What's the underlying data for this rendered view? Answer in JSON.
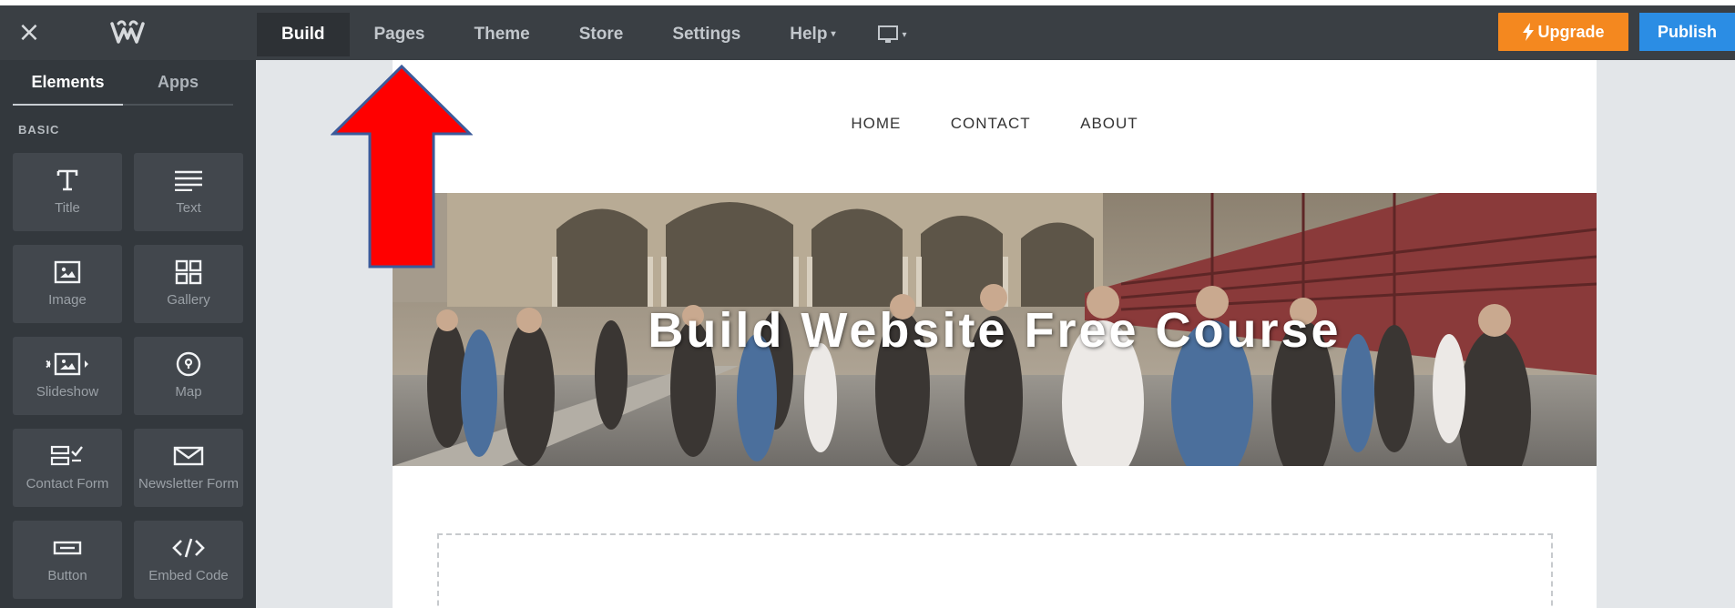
{
  "topbar": {
    "close_icon": "×",
    "logo_name": "weebly-w-logo",
    "nav": [
      {
        "label": "Build",
        "active": true
      },
      {
        "label": "Pages"
      },
      {
        "label": "Theme"
      },
      {
        "label": "Store"
      },
      {
        "label": "Settings"
      },
      {
        "label": "Help",
        "caret": "▾"
      }
    ],
    "device_icon": "desktop-icon",
    "upgrade_label": "Upgrade",
    "publish_label": "Publish",
    "colors": {
      "bar": "#3a3f44",
      "upgrade": "#f4881f",
      "publish": "#2b8de4"
    }
  },
  "sidebar": {
    "tabs": [
      {
        "label": "Elements",
        "active": true
      },
      {
        "label": "Apps"
      }
    ],
    "section_label": "BASIC",
    "elements": [
      {
        "label": "Title",
        "icon": "title-icon"
      },
      {
        "label": "Text",
        "icon": "text-icon"
      },
      {
        "label": "Image",
        "icon": "image-icon"
      },
      {
        "label": "Gallery",
        "icon": "gallery-icon"
      },
      {
        "label": "Slideshow",
        "icon": "slideshow-icon"
      },
      {
        "label": "Map",
        "icon": "map-pin-icon"
      },
      {
        "label": "Contact Form",
        "icon": "contact-form-icon"
      },
      {
        "label": "Newsletter Form",
        "icon": "newsletter-icon"
      },
      {
        "label": "Button",
        "icon": "button-icon"
      },
      {
        "label": "Embed Code",
        "icon": "code-icon"
      }
    ]
  },
  "page": {
    "nav": [
      "HOME",
      "CONTACT",
      "ABOUT"
    ],
    "hero_title": "Build Website Free Course"
  },
  "annotation": {
    "arrow_color": "#ff0000",
    "arrow_border": "#3b5a9a"
  }
}
